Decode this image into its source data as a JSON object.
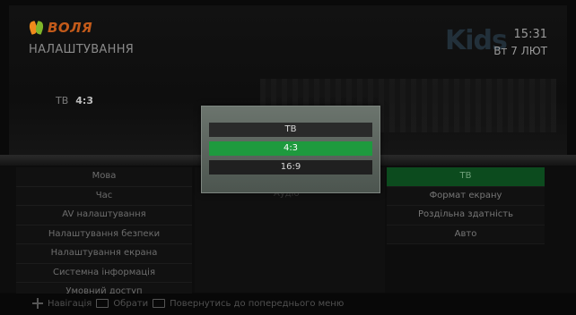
{
  "header": {
    "logo_text": "ВОЛЯ",
    "page_title": "НАЛАШТУВАННЯ",
    "channel_logo": "Kids",
    "time": "15:31",
    "date": "Вт 7 ЛЮТ"
  },
  "current_setting": {
    "label": "ТВ",
    "value": "4:3"
  },
  "menu": {
    "items": [
      {
        "label": "Мова"
      },
      {
        "label": "Час"
      },
      {
        "label": "AV налаштування"
      },
      {
        "label": "Налаштування безпеки"
      },
      {
        "label": "Налаштування екрана"
      },
      {
        "label": "Системна інформація"
      },
      {
        "label": "Умовний доступ"
      }
    ]
  },
  "middle": {
    "ghost_text": "Аудіо"
  },
  "options": {
    "items": [
      {
        "label": "ТВ",
        "active": true
      },
      {
        "label": "Формат екрану",
        "active": false
      },
      {
        "label": "Роздільна здатність",
        "active": false
      },
      {
        "label": "Авто",
        "active": false
      }
    ]
  },
  "popup": {
    "items": [
      {
        "label": "ТВ"
      },
      {
        "label": "4:3",
        "selected": true
      },
      {
        "label": "16:9"
      }
    ]
  },
  "hint": {
    "navigation": "Навігація",
    "select": "Обрати",
    "back": "Повернутись до попереднього меню"
  },
  "colors": {
    "accent_green": "#1e9a3e",
    "active_row": "#0c4b1e",
    "brand_orange": "#f08a1c",
    "brand_green": "#7fb62a"
  }
}
